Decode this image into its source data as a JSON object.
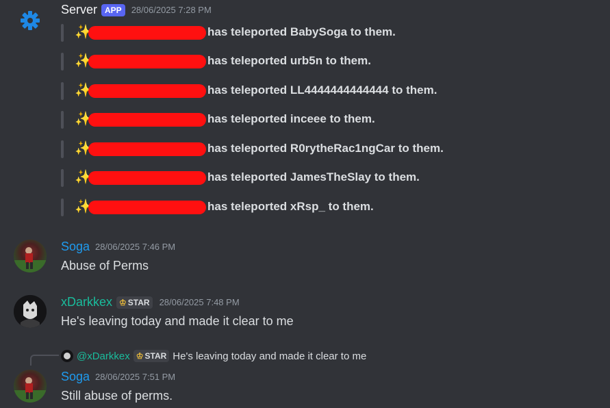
{
  "bot_message": {
    "author": "Server",
    "tag": "APP",
    "timestamp": "28/06/2025 7:28 PM",
    "lines": [
      {
        "emoji": "✨",
        "text": "has teleported BabySoga to them."
      },
      {
        "emoji": "✨",
        "text": "has teleported urb5n to them."
      },
      {
        "emoji": "✨",
        "text": "has teleported LL4444444444444 to them."
      },
      {
        "emoji": "✨",
        "text": "has teleported inceee to them."
      },
      {
        "emoji": "✨",
        "text": "has teleported R0rytheRac1ngCar to them."
      },
      {
        "emoji": "✨",
        "text": "has teleported JamesTheSlay to them."
      },
      {
        "emoji": "✨",
        "text": "has teleported xRsp_ to them."
      }
    ]
  },
  "messages": [
    {
      "author": "Soga",
      "timestamp": "28/06/2025 7:46 PM",
      "text": "Abuse of Perms"
    },
    {
      "author": "xDarkkex",
      "tag": "STAR",
      "timestamp": "28/06/2025 7:48 PM",
      "text": "He's leaving today and made it clear to me"
    },
    {
      "author": "Soga",
      "timestamp": "28/06/2025 7:51 PM",
      "text": "Still abuse of perms.",
      "reply": {
        "author": "@xDarkkex",
        "tag": "STAR",
        "text": "He's leaving today and made it clear to me"
      }
    }
  ],
  "colors": {
    "background": "#313338",
    "app_badge": "#5865f2",
    "soga_name": "#1f9bef",
    "xdarkkex_name": "#1abc9c",
    "gear_icon": "#1e88e5",
    "redaction": "#ff1010"
  }
}
